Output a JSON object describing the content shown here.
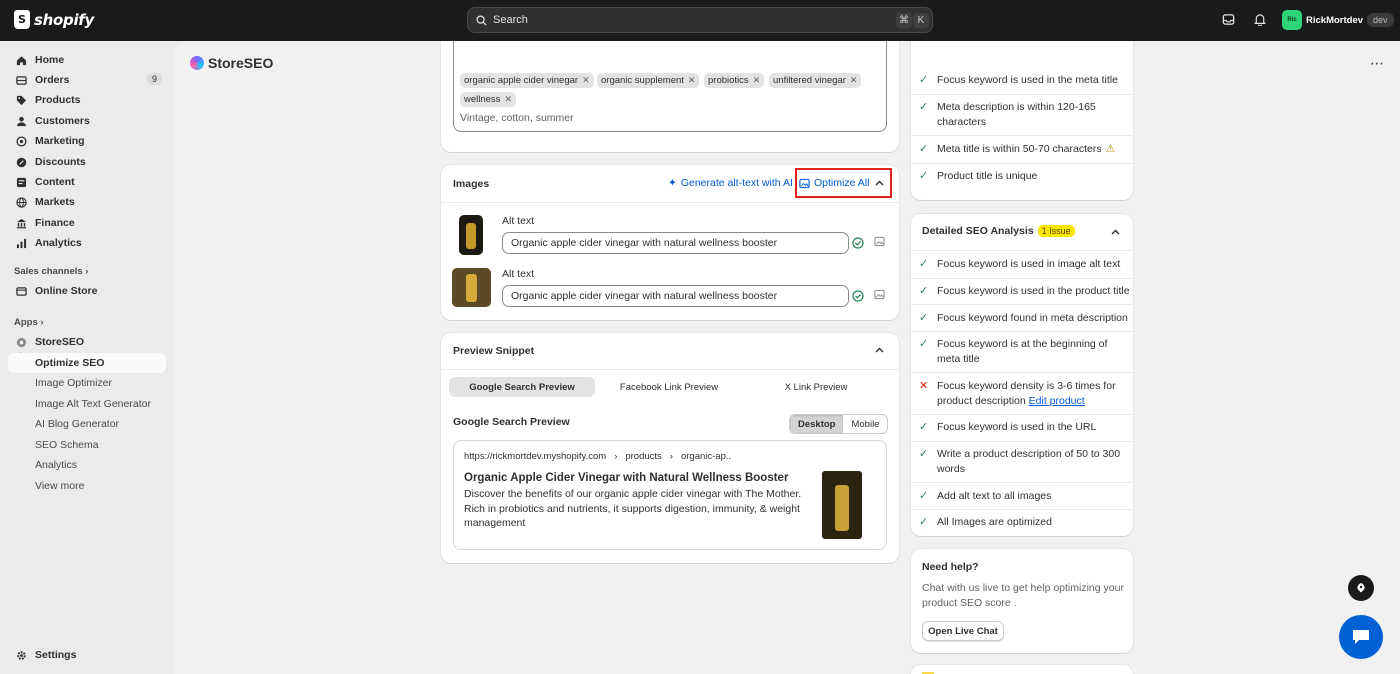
{
  "topbar": {
    "brand": "shopify",
    "search_placeholder": "Search",
    "shortcut_keys": [
      "⌘",
      "K"
    ],
    "user_initials": "Ric",
    "user_name": "RickMortdev",
    "store_badge": "dev"
  },
  "sidebar": {
    "items": [
      {
        "label": "Home",
        "icon": "home-icon"
      },
      {
        "label": "Orders",
        "icon": "orders-icon",
        "count": "9"
      },
      {
        "label": "Products",
        "icon": "tag-icon"
      },
      {
        "label": "Customers",
        "icon": "person-icon"
      },
      {
        "label": "Marketing",
        "icon": "target-icon"
      },
      {
        "label": "Discounts",
        "icon": "discount-icon"
      },
      {
        "label": "Content",
        "icon": "content-icon"
      },
      {
        "label": "Markets",
        "icon": "globe-icon"
      },
      {
        "label": "Finance",
        "icon": "bank-icon"
      },
      {
        "label": "Analytics",
        "icon": "chart-icon"
      }
    ],
    "sales_channels_label": "Sales channels",
    "online_store": "Online Store",
    "apps_label": "Apps",
    "app_name": "StoreSEO",
    "app_sub_items": [
      "Optimize SEO",
      "Image Optimizer",
      "Image Alt Text Generator",
      "AI Blog Generator",
      "SEO Schema",
      "Analytics",
      "View more"
    ],
    "settings": "Settings"
  },
  "app": {
    "title": "StoreSEO"
  },
  "tags": {
    "items": [
      "organic apple cider vinegar",
      "organic supplement",
      "probiotics",
      "unfiltered vinegar",
      "wellness"
    ],
    "placeholder": "Vintage, cotton, summer"
  },
  "images": {
    "title": "Images",
    "generate_label": "Generate alt-text with AI",
    "optimize_label": "Optimize All",
    "alt_label": "Alt text",
    "alt_values": [
      "Organic apple cider vinegar with natural wellness booster",
      "Organic apple cider vinegar with natural wellness booster"
    ]
  },
  "preview": {
    "title": "Preview Snippet",
    "tabs": [
      "Google Search Preview",
      "Facebook Link Preview",
      "X Link Preview"
    ],
    "subtitle": "Google Search Preview",
    "devices": [
      "Desktop",
      "Mobile"
    ],
    "crumbs": [
      "https://rickmortdev.myshopify.com",
      "products",
      "organic-ap.."
    ],
    "snippet_title": "Organic Apple Cider Vinegar with Natural Wellness Booster",
    "snippet_desc": "Discover the benefits of our organic apple cider vinegar with The Mother. Rich in probiotics and nutrients, it supports digestion, immunity, & weight management"
  },
  "basic_checks": [
    {
      "text": "Focus keyword is used in the meta title",
      "status": "ok"
    },
    {
      "text": "Meta description is within 120-165 characters",
      "status": "ok"
    },
    {
      "text": "Meta title is within 50-70 characters",
      "status": "warn"
    },
    {
      "text": "Product title is unique",
      "status": "ok"
    }
  ],
  "detailed": {
    "title": "Detailed SEO Analysis",
    "badge": "1 Issue",
    "checks": [
      {
        "text": "Focus keyword is used in image alt text",
        "status": "ok"
      },
      {
        "text": "Focus keyword is used in the product title",
        "status": "ok"
      },
      {
        "text": "Focus keyword found in meta description",
        "status": "ok"
      },
      {
        "text": "Focus keyword is at the beginning of meta title",
        "status": "ok"
      },
      {
        "text": "Focus keyword density is 3-6 times for product description",
        "status": "bad",
        "link": "Edit product"
      },
      {
        "text": "Focus keyword is used in the URL",
        "status": "ok"
      },
      {
        "text": "Write a product description of 50 to 300 words",
        "status": "ok"
      },
      {
        "text": "Add alt text to all images",
        "status": "ok"
      },
      {
        "text": "All Images are optimized",
        "status": "ok"
      }
    ]
  },
  "help": {
    "title": "Need help?",
    "text": "Chat with us live to get help optimizing your product SEO score .",
    "button": "Open Live Chat"
  },
  "colors": {
    "accent": "#005bd3",
    "success": "#29845a",
    "critical": "#e51c00",
    "highlight": "#e0201c"
  }
}
